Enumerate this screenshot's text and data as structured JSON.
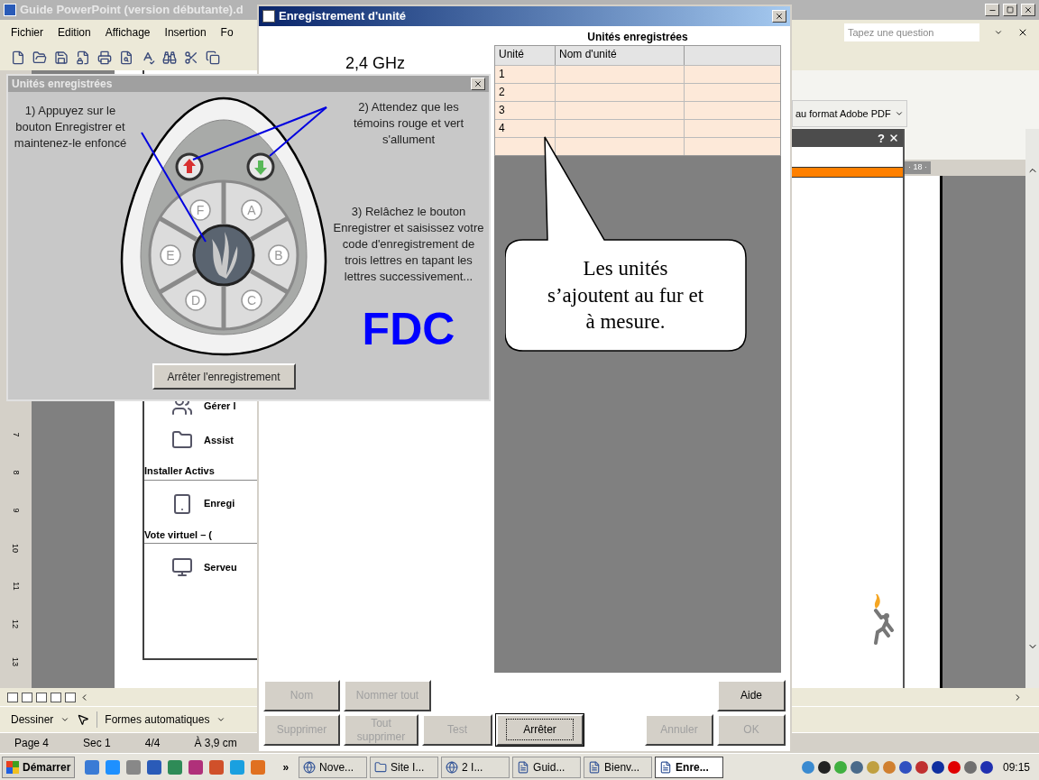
{
  "word_window": {
    "title": "Guide PowerPoint (version débutante).d",
    "menu": [
      "Fichier",
      "Edition",
      "Affichage",
      "Insertion",
      "Fo"
    ],
    "question_box": {
      "placeholder": "Tapez une question"
    },
    "pdf_button": "au format Adobe PDF",
    "task_pane_help": "?",
    "ruler_label": "· 18 ·",
    "vertical_ruler": [
      "7",
      "8",
      "9",
      "10",
      "11",
      "12",
      "13"
    ],
    "document_items": [
      {
        "kind": "entry",
        "text": "Gérer l"
      },
      {
        "kind": "entry",
        "text": "Assist"
      },
      {
        "kind": "heading",
        "text": "Installer Activs"
      },
      {
        "kind": "entry",
        "text": "Enregi"
      },
      {
        "kind": "heading",
        "text": "Vote virtuel – ("
      },
      {
        "kind": "entry",
        "text": "Serveu"
      }
    ],
    "drawing_toolbar": [
      "Dessiner",
      "Formes automatiques"
    ],
    "status_bar": [
      "Page 4",
      "Sec 1",
      "4/4",
      "À 3,9 cm"
    ]
  },
  "registration_window": {
    "title": "Enregistrement d'unité",
    "frequency": "2,4 GHz",
    "table": {
      "title": "Unités enregistrées",
      "columns": [
        "Unité",
        "Nom d'unité"
      ],
      "rows": [
        {
          "unit": "1"
        },
        {
          "unit": "2"
        },
        {
          "unit": "3"
        },
        {
          "unit": "4"
        }
      ]
    },
    "callout": "Les unités s’ajoutent au fur et à mesure.",
    "button_rows": [
      {
        "left": [
          {
            "label": "Nom",
            "disabled": true,
            "focused": false
          },
          {
            "label": "Nommer tout",
            "disabled": true,
            "focused": false
          }
        ],
        "right": [
          {
            "label": "Aide",
            "disabled": false,
            "focused": false
          }
        ]
      },
      {
        "left": [
          {
            "label": "Supprimer",
            "disabled": true,
            "focused": false
          },
          {
            "label": "Tout supprimer",
            "disabled": true,
            "focused": false
          },
          {
            "label": "Test",
            "disabled": true,
            "focused": false
          },
          {
            "label": "Arrêter",
            "disabled": false,
            "focused": true
          }
        ],
        "right": [
          {
            "label": "Annuler",
            "disabled": true,
            "focused": false
          },
          {
            "label": "OK",
            "disabled": true,
            "focused": false
          }
        ]
      }
    ]
  },
  "dialog": {
    "title": "Unités enregistrées",
    "steps": [
      "1) Appuyez sur le bouton Enregistrer et maintenez-le enfoncé",
      "2) Attendez que les témoins rouge et vert s'allument",
      "3) Relâchez le bouton Enregistrer et saisissez votre code d'enregistrement de trois lettres en tapant les lettres successivement..."
    ],
    "leds": [
      {
        "color": "#d83030"
      },
      {
        "color": "#58b858"
      }
    ],
    "keys": [
      "F",
      "A",
      "E",
      "B",
      "D",
      "C"
    ],
    "code": "FDC",
    "stop_button": "Arrêter l'enregistrement"
  },
  "taskbar": {
    "start": "Démarrer",
    "overflow": "»",
    "tasks": [
      {
        "label": "Nove...",
        "selected": false
      },
      {
        "label": "Site I...",
        "selected": false
      },
      {
        "label": "2 I...",
        "selected": false
      },
      {
        "label": "Guid...",
        "selected": false
      },
      {
        "label": "Bienv...",
        "selected": false
      },
      {
        "label": "Enre...",
        "selected": true
      }
    ],
    "clock": "09:15"
  }
}
